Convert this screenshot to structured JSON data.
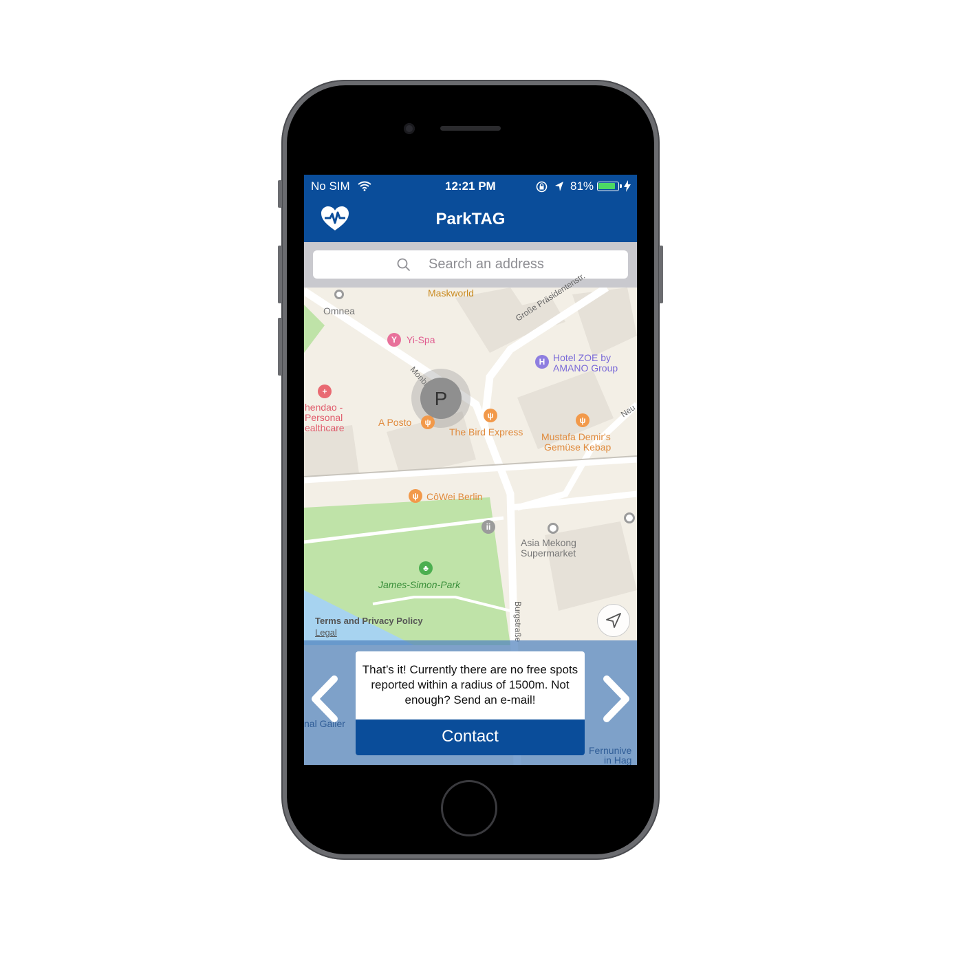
{
  "status_bar": {
    "carrier": "No SIM",
    "time": "12:21 PM",
    "battery_percent": "81%"
  },
  "header": {
    "title": "ParkTAG",
    "logo_icon": "heart-pulse-icon"
  },
  "search": {
    "placeholder": "Search an address"
  },
  "map": {
    "labels": {
      "maskworld": "Maskworld",
      "omnea": "Omnea",
      "yispa": "Yi-Spa",
      "street_praesident": "Große Präsidentenstr.",
      "hotel_line1": "Hotel ZOE by",
      "hotel_line2": "AMANO Group",
      "monbijou": "Monbijouplatz",
      "parking": "P",
      "shendao_line1": "hendao -",
      "shendao_line2": "Personal",
      "shendao_line3": "ealthcare",
      "aposto": "A Posto",
      "bird": "The Bird Express",
      "mustafa_line1": "Mustafa Demir's",
      "mustafa_line2": "Gemüse Kebap",
      "neue": "Neu",
      "cowei": "CôWei Berlin",
      "asia_line1": "Asia Mekong",
      "asia_line2": "Supermarket",
      "park": "James-Simon-Park",
      "terms": "Terms and Privacy Policy",
      "legal": "Legal",
      "burgstrasse": "Burgstraße",
      "gallery": "nal Galler",
      "fernuni_line1": "Fernunive",
      "fernuni_line2": "in Hag"
    }
  },
  "info_panel": {
    "message": "That’s it! Currently there are no free spots reported within a radius of 1500m. Not enough? Send an e-mail!",
    "contact_label": "Contact"
  },
  "colors": {
    "brand": "#0a4d9a",
    "map_bg": "#f3efe6",
    "park": "#bfe3a8",
    "water": "#a7d3f0"
  }
}
